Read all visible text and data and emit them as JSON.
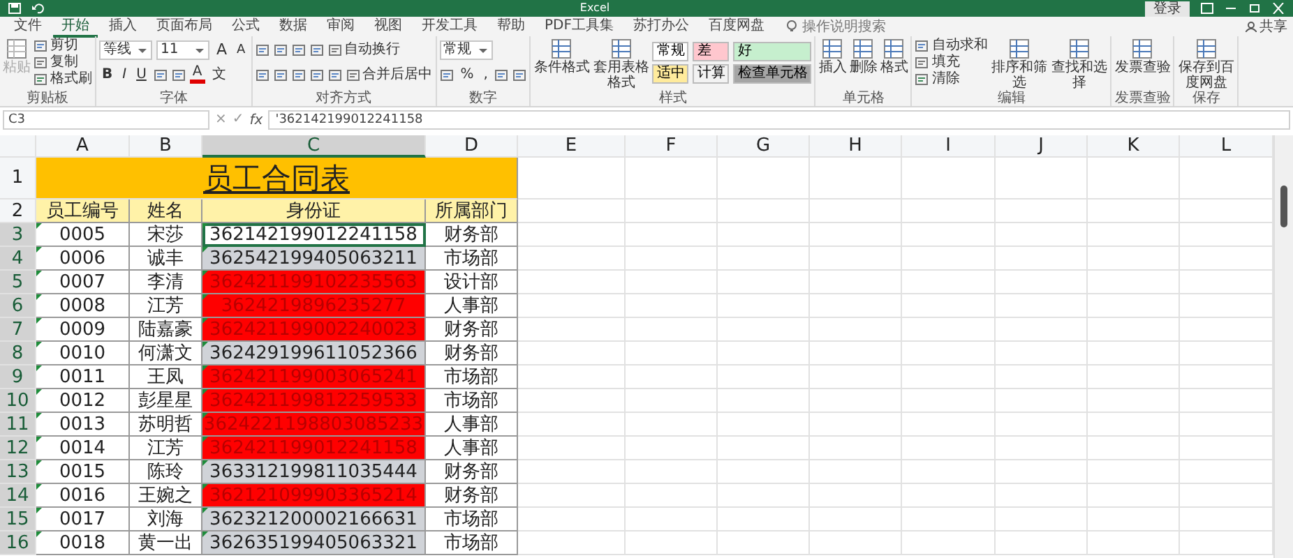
{
  "window": {
    "title": "Excel",
    "sign_in": "登录",
    "share": "共享"
  },
  "tabs": [
    {
      "label": "文件",
      "selected": false
    },
    {
      "label": "开始",
      "selected": true
    },
    {
      "label": "插入",
      "selected": false
    },
    {
      "label": "页面布局",
      "selected": false
    },
    {
      "label": "公式",
      "selected": false
    },
    {
      "label": "数据",
      "selected": false
    },
    {
      "label": "审阅",
      "selected": false
    },
    {
      "label": "视图",
      "selected": false
    },
    {
      "label": "开发工具",
      "selected": false
    },
    {
      "label": "帮助",
      "selected": false
    },
    {
      "label": "PDF工具集",
      "selected": false
    },
    {
      "label": "苏打办公",
      "selected": false
    },
    {
      "label": "百度网盘",
      "selected": false
    }
  ],
  "tell_me": {
    "placeholder": "操作说明搜索"
  },
  "ribbon": {
    "groups": [
      {
        "label": "剪贴板",
        "items": [
          {
            "kind": "large",
            "label": "粘贴",
            "disabled": true
          },
          {
            "kind": "stack",
            "items": [
              {
                "label": "剪切"
              },
              {
                "label": "复制"
              },
              {
                "label": "格式刷"
              }
            ]
          }
        ]
      },
      {
        "label": "字体",
        "items": [
          {
            "kind": "rows",
            "lines": [
              {
                "controls": [
                  {
                    "kind": "select",
                    "value": "等线"
                  },
                  {
                    "kind": "select",
                    "value": "11"
                  },
                  {
                    "kind": "grow",
                    "label": "A"
                  },
                  {
                    "kind": "shrink",
                    "label": "A"
                  }
                ]
              },
              {
                "controls": [
                  {
                    "kind": "bold",
                    "label": "B"
                  },
                  {
                    "kind": "italic",
                    "label": "I"
                  },
                  {
                    "kind": "underline",
                    "label": "U"
                  },
                  {
                    "kind": "icon"
                  },
                  {
                    "kind": "icon"
                  },
                  {
                    "kind": "fontcolor",
                    "label": "A"
                  },
                  {
                    "kind": "button",
                    "label": "文"
                  }
                ]
              }
            ]
          }
        ]
      },
      {
        "label": "对齐方式",
        "items": [
          {
            "kind": "rows",
            "lines": [
              {
                "controls": [
                  {
                    "kind": "icon"
                  },
                  {
                    "kind": "icon"
                  },
                  {
                    "kind": "icon"
                  },
                  {
                    "kind": "icon"
                  },
                  {
                    "kind": "icon-label",
                    "label": "自动换行"
                  }
                ]
              },
              {
                "controls": [
                  {
                    "kind": "icon"
                  },
                  {
                    "kind": "icon"
                  },
                  {
                    "kind": "icon"
                  },
                  {
                    "kind": "icon"
                  },
                  {
                    "kind": "icon"
                  },
                  {
                    "kind": "icon-label",
                    "label": "合并后居中"
                  }
                ]
              }
            ]
          }
        ]
      },
      {
        "label": "数字",
        "items": [
          {
            "kind": "rows",
            "lines": [
              {
                "controls": [
                  {
                    "kind": "select",
                    "value": "常规"
                  }
                ]
              },
              {
                "controls": [
                  {
                    "kind": "icon"
                  },
                  {
                    "kind": "button",
                    "label": "%"
                  },
                  {
                    "kind": "button",
                    "label": ","
                  },
                  {
                    "kind": "icon"
                  },
                  {
                    "kind": "icon"
                  }
                ]
              }
            ]
          }
        ]
      },
      {
        "label": "样式",
        "items": [
          {
            "kind": "large",
            "label": "条件格式",
            "disabled": false
          },
          {
            "kind": "large",
            "label": "套用表格格式",
            "disabled": false
          },
          {
            "kind": "styles",
            "cells": [
              {
                "label": "常规",
                "color": "#ffffff"
              },
              {
                "label": "差",
                "color": "#ffc7ce"
              },
              {
                "label": "好",
                "color": "#c6efce"
              },
              {
                "label": "适中",
                "color": "#ffeb9c"
              },
              {
                "label": "计算",
                "color": "#f2f2f2"
              },
              {
                "label": "检查单元格",
                "color": "#a5a5a5"
              }
            ]
          }
        ]
      },
      {
        "label": "单元格",
        "items": [
          {
            "kind": "large",
            "label": "插入",
            "disabled": false
          },
          {
            "kind": "large",
            "label": "删除",
            "disabled": false
          },
          {
            "kind": "large",
            "label": "格式",
            "disabled": false
          }
        ]
      },
      {
        "label": "编辑",
        "items": [
          {
            "kind": "stack",
            "items": [
              {
                "label": "自动求和"
              },
              {
                "label": "填充"
              },
              {
                "label": "清除"
              }
            ]
          },
          {
            "kind": "large",
            "label": "排序和筛选",
            "disabled": false
          },
          {
            "kind": "large",
            "label": "查找和选择",
            "disabled": false
          }
        ]
      },
      {
        "label": "发票查验",
        "items": [
          {
            "kind": "large",
            "label": "发票查验",
            "disabled": false
          }
        ]
      },
      {
        "label": "保存",
        "items": [
          {
            "kind": "large",
            "label": "保存到百度网盘",
            "disabled": false
          }
        ]
      }
    ]
  },
  "formula_bar": {
    "name_box": "C3",
    "cancel": "×",
    "enter": "✓",
    "fx": "fx",
    "value": "'362142199012241158"
  },
  "sheet": {
    "columns": [
      {
        "label": "A",
        "selected": false
      },
      {
        "label": "B",
        "selected": false
      },
      {
        "label": "C",
        "selected": true
      },
      {
        "label": "D",
        "selected": false
      },
      {
        "label": "E",
        "selected": false
      },
      {
        "label": "F",
        "selected": false
      },
      {
        "label": "G",
        "selected": false
      },
      {
        "label": "H",
        "selected": false
      },
      {
        "label": "I",
        "selected": false
      },
      {
        "label": "J",
        "selected": false
      },
      {
        "label": "K",
        "selected": false
      },
      {
        "label": "L",
        "selected": false
      }
    ],
    "title": {
      "row": "1",
      "text": "员工合同表"
    },
    "header": {
      "row": "2",
      "cells": [
        "员工编号",
        "姓名",
        "身份证",
        "所属部门"
      ]
    },
    "rows": [
      {
        "row": "3",
        "selected": true,
        "no": "0005",
        "name": "宋莎",
        "id": {
          "text": "362142199012241158",
          "color": "#ffffff",
          "active": true
        },
        "dept": "财务部"
      },
      {
        "row": "4",
        "selected": true,
        "no": "0006",
        "name": "诚丰",
        "id": {
          "text": "362542199405063211",
          "color": "#d0d3d8",
          "active": false
        },
        "dept": "市场部"
      },
      {
        "row": "5",
        "selected": true,
        "no": "0007",
        "name": "李清",
        "id": {
          "text": "362421199102235563",
          "color": "#ff0000",
          "active": false
        },
        "dept": "设计部"
      },
      {
        "row": "6",
        "selected": true,
        "no": "0008",
        "name": "江芳",
        "id": {
          "text": "3624219896235277",
          "color": "#ff0000",
          "active": false
        },
        "dept": "人事部"
      },
      {
        "row": "7",
        "selected": true,
        "no": "0009",
        "name": "陆嘉豪",
        "id": {
          "text": "362421199002240023",
          "color": "#ff0000",
          "active": false
        },
        "dept": "财务部"
      },
      {
        "row": "8",
        "selected": true,
        "no": "0010",
        "name": "何潇文",
        "id": {
          "text": "362429199611052366",
          "color": "#d0d3d8",
          "active": false
        },
        "dept": "财务部"
      },
      {
        "row": "9",
        "selected": true,
        "no": "0011",
        "name": "王凤",
        "id": {
          "text": "362421199003065241",
          "color": "#ff0000",
          "active": false
        },
        "dept": "市场部"
      },
      {
        "row": "10",
        "selected": true,
        "no": "0012",
        "name": "彭星星",
        "id": {
          "text": "362421199812259533",
          "color": "#ff0000",
          "active": false
        },
        "dept": "市场部"
      },
      {
        "row": "11",
        "selected": true,
        "no": "0013",
        "name": "苏明哲",
        "id": {
          "text": "3624221198803085233",
          "color": "#ff0000",
          "active": false
        },
        "dept": "人事部"
      },
      {
        "row": "12",
        "selected": true,
        "no": "0014",
        "name": "江芳",
        "id": {
          "text": "362421199012241158",
          "color": "#ff0000",
          "active": false
        },
        "dept": "人事部"
      },
      {
        "row": "13",
        "selected": true,
        "no": "0015",
        "name": "陈玲",
        "id": {
          "text": "363312199811035444",
          "color": "#d0d3d8",
          "active": false
        },
        "dept": "财务部"
      },
      {
        "row": "14",
        "selected": true,
        "no": "0016",
        "name": "王婉之",
        "id": {
          "text": "362121099903365214",
          "color": "#ff0000",
          "active": false
        },
        "dept": "财务部"
      },
      {
        "row": "15",
        "selected": true,
        "no": "0017",
        "name": "刘海",
        "id": {
          "text": "362321200002166631",
          "color": "#d0d3d8",
          "active": false
        },
        "dept": "市场部"
      },
      {
        "row": "16",
        "selected": true,
        "no": "0018",
        "name": "黄一出",
        "id": {
          "text": "362635199405063321",
          "color": "#d0d3d8",
          "active": false
        },
        "dept": "市场部"
      }
    ]
  }
}
